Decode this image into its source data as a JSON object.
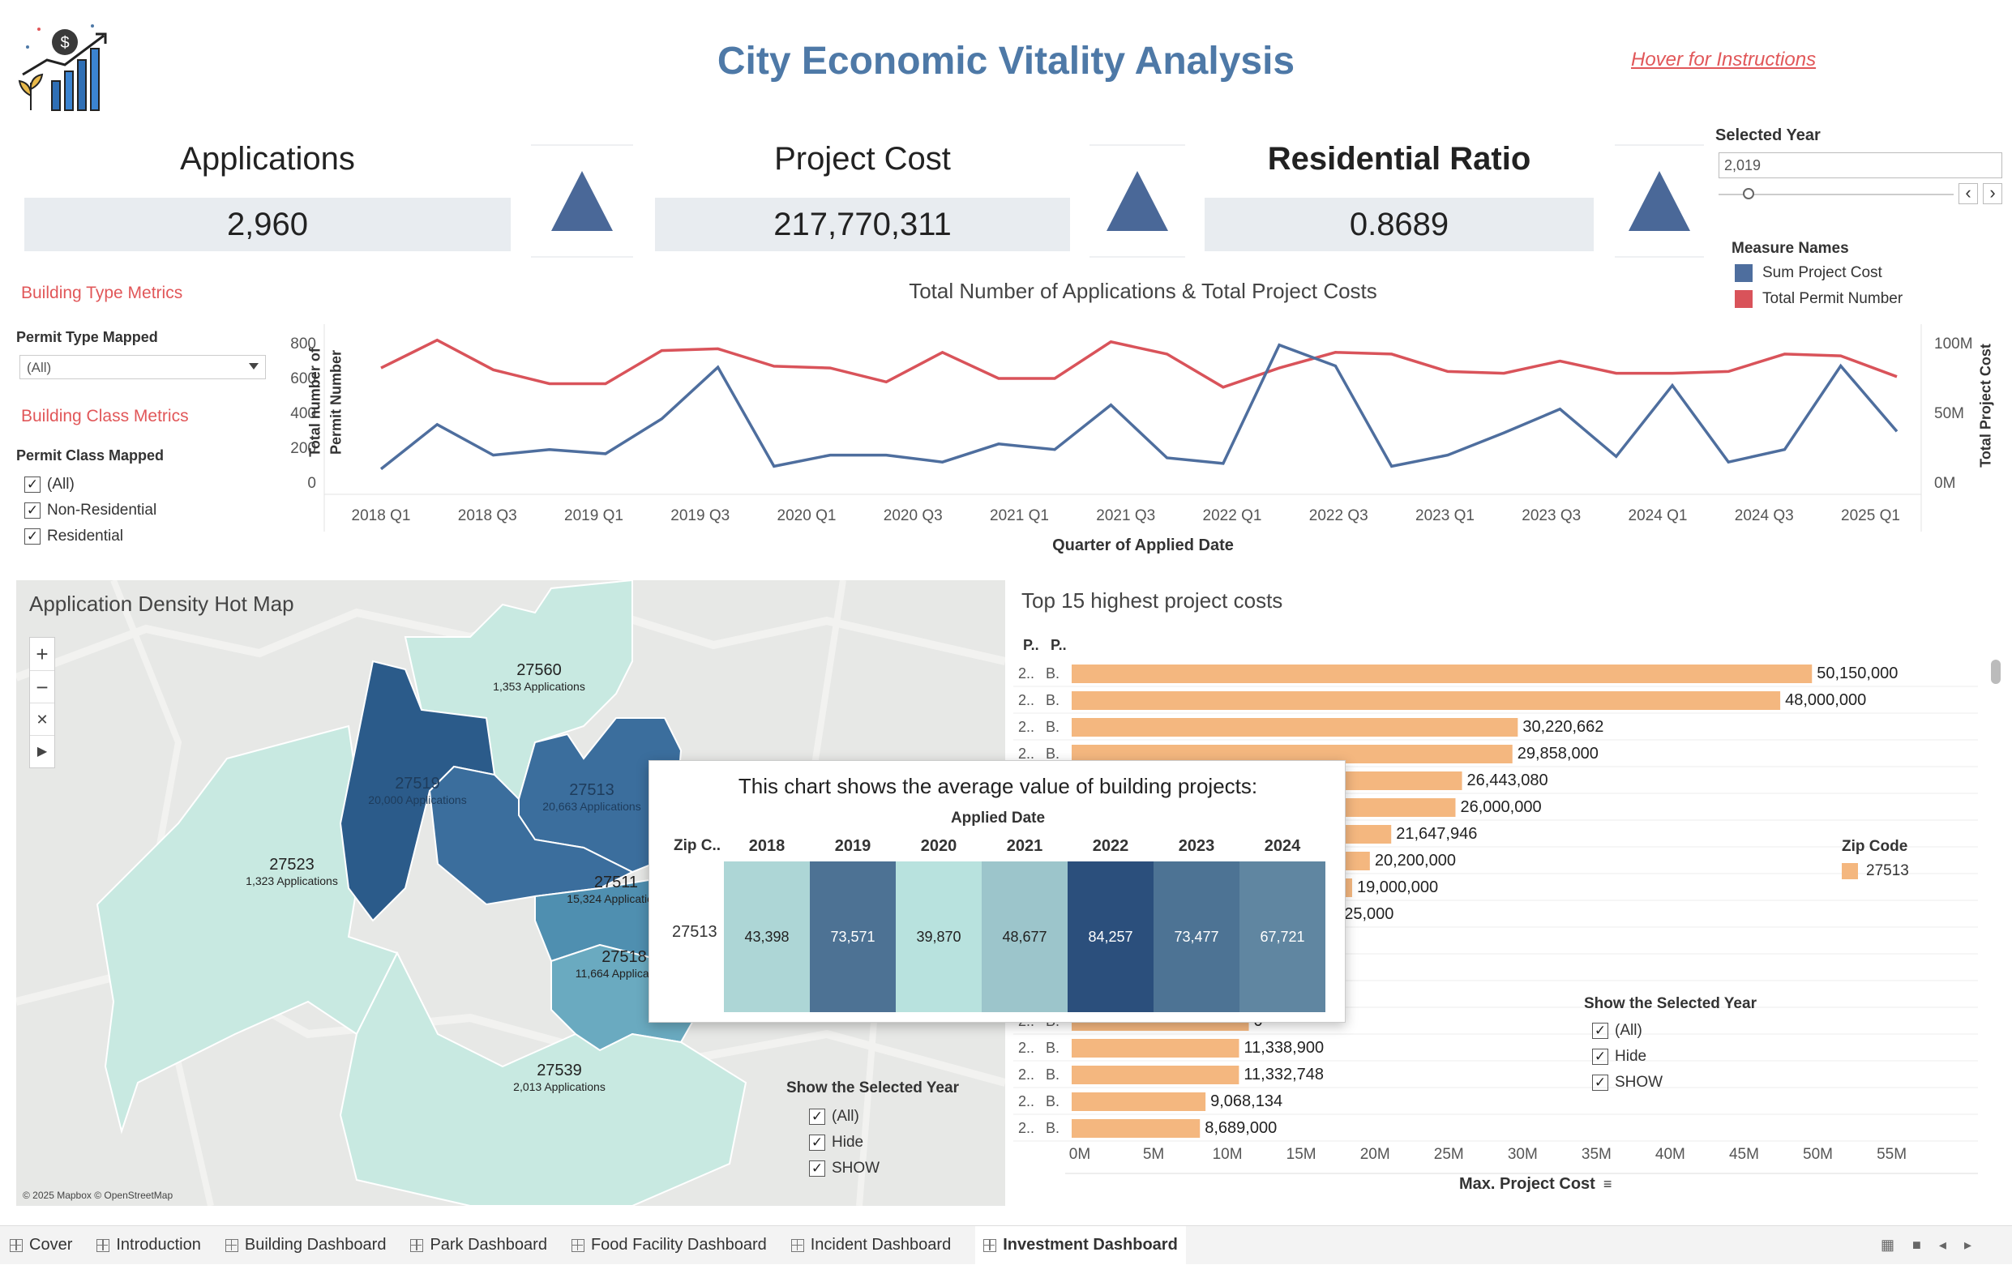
{
  "header": {
    "title": "City Economic Vitality Analysis",
    "hover_link": "Hover for Instructions",
    "logo_icon": "growth-chart-dollar-icon"
  },
  "kpis": {
    "applications": {
      "label": "Applications",
      "value": "2,960"
    },
    "project_cost": {
      "label": "Project Cost",
      "value": "217,770,311"
    },
    "residential_ratio": {
      "label": "Residential Ratio",
      "value": "0.8689"
    },
    "trend_icon": "triangle-up-icon",
    "trend_color": "#4a6898"
  },
  "year_selector": {
    "label": "Selected Year",
    "value": "2,019",
    "prev": "‹",
    "next": "›"
  },
  "filters": {
    "building_type_title": "Building Type Metrics",
    "permit_type_label": "Permit Type Mapped",
    "permit_type_value": "(All)",
    "building_class_title": "Building Class Metrics",
    "permit_class_label": "Permit Class Mapped",
    "permit_class_options": [
      "(All)",
      "Non-Residential",
      "Residential"
    ]
  },
  "legend": {
    "title": "Measure Names",
    "items": [
      {
        "label": "Sum Project Cost",
        "color": "#4e6e9e"
      },
      {
        "label": "Total Permit Number",
        "color": "#d9535a"
      }
    ]
  },
  "line_chart": {
    "title": "Total Number of Applications & Total Project Costs",
    "xlabel": "Quarter of Applied Date",
    "ylabel_left_1": "Total number of",
    "ylabel_left_2": "Permit Number",
    "ylabel_right": "Total Project Cost"
  },
  "map": {
    "title": "Application Density Hot Map",
    "attribution": "© 2025 Mapbox © OpenStreetMap",
    "zoom_in": "+",
    "zoom_out": "−",
    "regions": [
      {
        "zip": "27560",
        "apps": "1,353 Applications"
      },
      {
        "zip": "27519",
        "apps": "20,000 Applications"
      },
      {
        "zip": "27513",
        "apps": "20,663 Applications"
      },
      {
        "zip": "27523",
        "apps": "1,323 Applications"
      },
      {
        "zip": "27511",
        "apps": "15,324 Applications"
      },
      {
        "zip": "27518",
        "apps": "11,664 Applications"
      },
      {
        "zip": "27539",
        "apps": "2,013 Applications"
      }
    ],
    "show_year_title": "Show the Selected Year",
    "show_year_options": [
      "(All)",
      "Hide",
      "SHOW"
    ]
  },
  "tooltip": {
    "title": "This chart shows the average value of building projects:",
    "col_group": "Applied Date",
    "row_header": "Zip C..",
    "years": [
      "2018",
      "2019",
      "2020",
      "2021",
      "2022",
      "2023",
      "2024"
    ],
    "zip": "27513",
    "values": [
      "43,398",
      "73,571",
      "39,870",
      "48,677",
      "84,257",
      "73,477",
      "67,721"
    ]
  },
  "bar_panel": {
    "title": "Top 15 highest project costs",
    "col1": "P..",
    "col2": "P..",
    "row_p1": "2..",
    "row_p2": "B.",
    "visible_labels": [
      "50,150,000",
      "48,000,000",
      "30,220,662",
      "29,858,000",
      "26,443,080",
      "26,000,000",
      "21,647,946",
      "20,200,000",
      "19,000,000",
      "525,000",
      ",100",
      "0",
      "0",
      "0",
      "11,338,900",
      "11,332,748",
      "9,068,134",
      "8,689,000"
    ],
    "xlabel": "Max. Project Cost",
    "zip_legend_title": "Zip Code",
    "zip_legend_value": "27513",
    "show_year_title": "Show the Selected Year",
    "show_year_options": [
      "(All)",
      "Hide",
      "SHOW"
    ]
  },
  "chart_data": [
    {
      "type": "line",
      "title": "Total Number of Applications & Total Project Costs",
      "xlabel": "Quarter of Applied Date",
      "ylabel": "Total number of Permit Number",
      "y2label": "Total Project Cost",
      "x_ticks": [
        "2018 Q1",
        "2018 Q3",
        "2019 Q1",
        "2019 Q3",
        "2020 Q1",
        "2020 Q3",
        "2021 Q1",
        "2021 Q3",
        "2022 Q1",
        "2022 Q3",
        "2023 Q1",
        "2023 Q3",
        "2024 Q1",
        "2024 Q3",
        "2025 Q1"
      ],
      "ylim": [
        0,
        800
      ],
      "y_ticks": [
        "0",
        "200",
        "400",
        "600",
        "800"
      ],
      "y2lim": [
        0,
        100
      ],
      "y2_ticks": [
        "0M",
        "50M",
        "100M"
      ],
      "series": [
        {
          "name": "Total Permit Number",
          "color": "#d9535a",
          "axis": "left",
          "values": [
            660,
            820,
            650,
            570,
            570,
            760,
            770,
            670,
            660,
            580,
            750,
            600,
            600,
            810,
            740,
            550,
            660,
            750,
            740,
            640,
            630,
            700,
            630,
            630,
            640,
            740,
            730,
            610
          ]
        },
        {
          "name": "Sum Project Cost",
          "color": "#4e6e9e",
          "axis": "right",
          "values": [
            10,
            42,
            20,
            24,
            21,
            46,
            83,
            12,
            20,
            20,
            15,
            28,
            24,
            56,
            18,
            14,
            99,
            84,
            12,
            20,
            36,
            53,
            19,
            70,
            15,
            24,
            84,
            37
          ]
        }
      ]
    },
    {
      "type": "bar",
      "title": "Top 15 highest project costs",
      "xlabel": "Max. Project Cost",
      "x_ticks": [
        "0M",
        "5M",
        "10M",
        "15M",
        "20M",
        "25M",
        "30M",
        "35M",
        "40M",
        "45M",
        "50M",
        "55M"
      ],
      "xlim": [
        0,
        57
      ],
      "color": "#f4b77f",
      "values": [
        50150000,
        48000000,
        30220662,
        29858000,
        26443080,
        26000000,
        21647946,
        20200000,
        19000000,
        17525000,
        15100000,
        14000000,
        13000000,
        12000000,
        11338900,
        11332748,
        9068134,
        8689000
      ]
    },
    {
      "type": "heatmap",
      "title": "This chart shows the average value of building projects:",
      "x": [
        "2018",
        "2019",
        "2020",
        "2021",
        "2022",
        "2023",
        "2024"
      ],
      "y": [
        "27513"
      ],
      "values": [
        43398,
        73571,
        39870,
        48677,
        84257,
        73477,
        67721
      ]
    }
  ]
}
